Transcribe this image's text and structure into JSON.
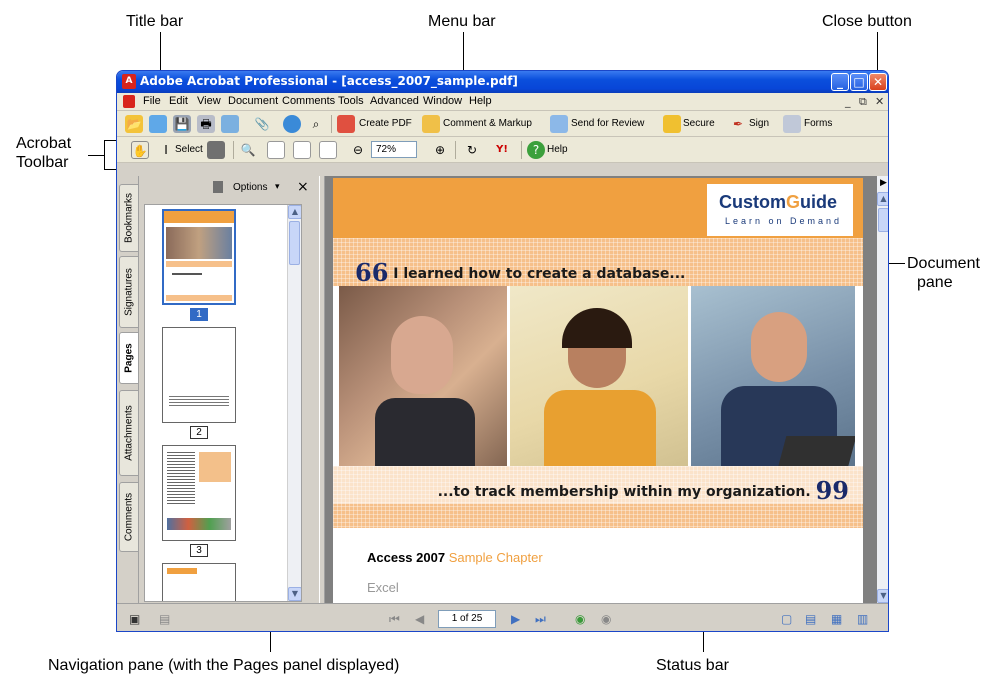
{
  "callouts": {
    "title_bar": "Title bar",
    "menu_bar": "Menu bar",
    "close_button": "Close button",
    "acrobat_toolbar_line1": "Acrobat",
    "acrobat_toolbar_line2": "Toolbar",
    "document_pane_line1": "Document",
    "document_pane_line2": "pane",
    "navigation_pane": "Navigation pane (with the Pages panel displayed)",
    "status_bar": "Status bar"
  },
  "window": {
    "title": "Adobe Acrobat Professional - [access_2007_sample.pdf]",
    "minimize": "_",
    "maximize": "□",
    "close": "✕"
  },
  "menu": {
    "items": [
      "File",
      "Edit",
      "View",
      "Document",
      "Comments",
      "Tools",
      "Advanced",
      "Window",
      "Help"
    ],
    "doc_min": "_",
    "doc_restore": "⧉",
    "doc_close": "✕"
  },
  "toolbar1": {
    "create_pdf": "Create PDF",
    "comment_markup": "Comment & Markup",
    "send_for_review": "Send for Review",
    "secure": "Secure",
    "sign": "Sign",
    "forms": "Forms"
  },
  "toolbar2": {
    "select": "Select",
    "zoom_value": "72%",
    "help": "Help"
  },
  "side_tabs": [
    "Bookmarks",
    "Signatures",
    "Pages",
    "Attachments",
    "Comments"
  ],
  "nav": {
    "options": "Options",
    "close": "×",
    "pages": [
      "1",
      "2",
      "3"
    ]
  },
  "document": {
    "logo_brand_a": "Custom",
    "logo_brand_b": "G",
    "logo_brand_c": "uide",
    "logo_tagline": "Learn on Demand",
    "quote_open_mark": "66",
    "quote_open_text": "I learned how to create a database...",
    "quote_close_text": "...to track membership within my organization.",
    "quote_close_mark": "99",
    "chapter_title": "Access 2007",
    "chapter_sub": "Sample Chapter",
    "next_heading": "Excel"
  },
  "status": {
    "page_field": "1 of 25"
  },
  "colors": {
    "title_blue": "#0a4fdc",
    "banner_orange": "#f0a040",
    "logo_navy": "#1a3a7a"
  }
}
